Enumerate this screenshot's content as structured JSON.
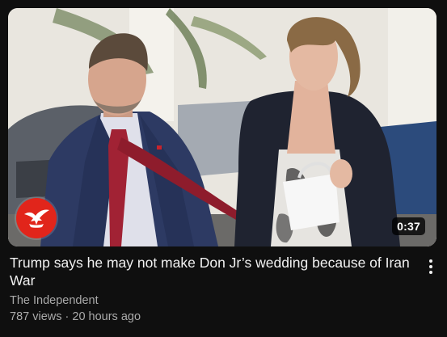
{
  "video": {
    "title": "Trump says he may not make Don Jr’s wedding because of Iran War",
    "channel": "The Independent",
    "views": "787 views",
    "age": "20 hours ago",
    "duration": "0:37"
  },
  "icons": {
    "channel_logo": "eagle-icon",
    "more": "more-vertical-icon"
  },
  "colors": {
    "background": "#0f0f0f",
    "channel_logo": "#e1251b",
    "secondary_text": "#aaaaaa"
  }
}
